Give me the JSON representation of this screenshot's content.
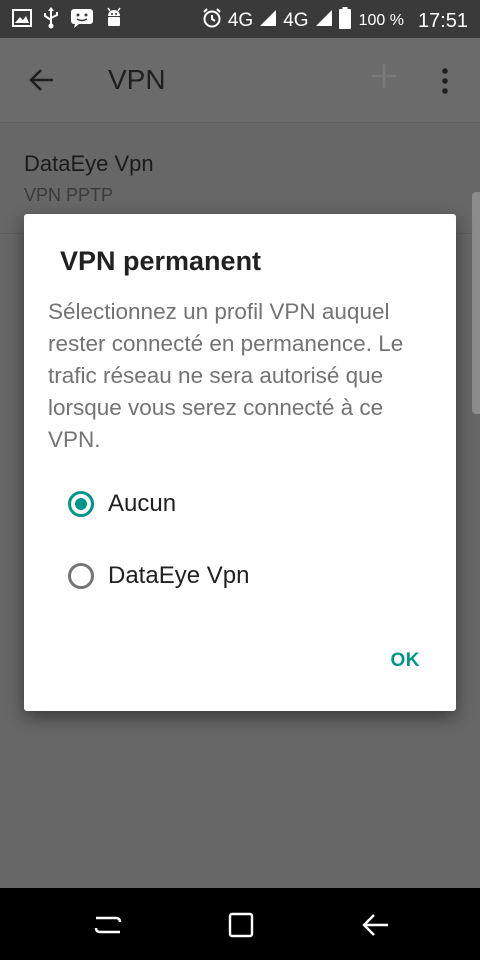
{
  "status_bar": {
    "network_1": "4G",
    "network_2": "4G",
    "battery": "100 %",
    "time": "17:51",
    "icons": [
      "image-icon",
      "usb-icon",
      "messenger-icon",
      "android-debug-icon",
      "alarm-icon",
      "signal-icon",
      "battery-icon"
    ]
  },
  "app_bar": {
    "title": "VPN",
    "icons": [
      "back-arrow-icon",
      "add-icon",
      "more-vert-icon"
    ]
  },
  "vpn_profile": {
    "name": "DataEye Vpn",
    "type": "VPN PPTP"
  },
  "dialog": {
    "title": "VPN permanent",
    "message": "Sélectionnez un profil VPN auquel rester connecté en permanence. Le trafic réseau ne sera autorisé que lorsque vous serez connecté à ce VPN.",
    "options": [
      {
        "label": "Aucun",
        "selected": true
      },
      {
        "label": "DataEye Vpn",
        "selected": false
      }
    ],
    "ok_label": "OK"
  },
  "nav_bar": {
    "icons": [
      "recents-icon",
      "home-icon",
      "back-icon"
    ]
  },
  "colors": {
    "accent": "#009688",
    "scrim_background": "#676767",
    "status_bar": "#3a3a3a"
  }
}
